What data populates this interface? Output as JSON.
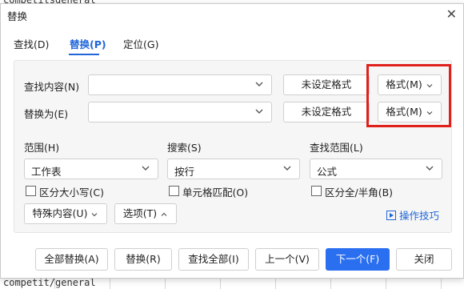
{
  "background": {
    "top_text": "competitsgeneral",
    "bottom_text": "competit/general"
  },
  "dialog": {
    "title": "替换",
    "close_glyph": "✕"
  },
  "tabs": [
    {
      "label": "查找(D)",
      "active": false
    },
    {
      "label": "替换(P)",
      "active": true
    },
    {
      "label": "定位(G)",
      "active": false
    }
  ],
  "find": {
    "label": "查找内容(N)",
    "value": "",
    "format_status": "未设定格式",
    "format_button": "格式(M)"
  },
  "replace": {
    "label": "替换为(E)",
    "value": "",
    "format_status": "未设定格式",
    "format_button": "格式(M)"
  },
  "options": {
    "scope": {
      "label": "范围(H)",
      "value": "工作表"
    },
    "search": {
      "label": "搜索(S)",
      "value": "按行"
    },
    "look_in": {
      "label": "查找范围(L)",
      "value": "公式"
    },
    "match_case": {
      "label": "区分大小写(C)",
      "checked": false
    },
    "match_cell": {
      "label": "单元格匹配(O)",
      "checked": false
    },
    "match_width": {
      "label": "区分全/半角(B)",
      "checked": false
    },
    "special_content": "特殊内容(U)",
    "options_toggle": "选项(T)",
    "tips_link": "操作技巧"
  },
  "buttons": {
    "replace_all": "全部替换(A)",
    "replace": "替换(R)",
    "find_all": "查找全部(I)",
    "prev": "上一个(V)",
    "next": "下一个(F)",
    "close": "关闭"
  },
  "colors": {
    "accent": "#2a6ff0",
    "tab_active": "#2166d8",
    "highlight_box": "#e0201b"
  }
}
